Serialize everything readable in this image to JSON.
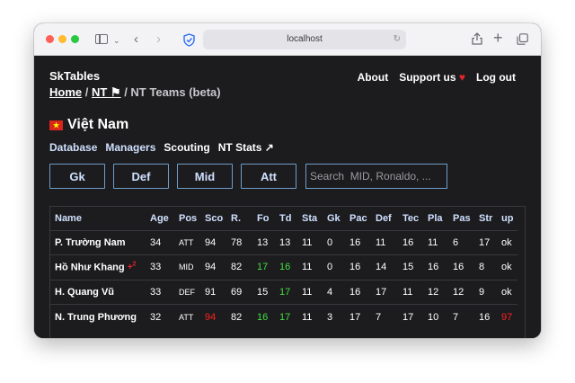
{
  "browser": {
    "url": "localhost"
  },
  "header": {
    "brand": "SkTables",
    "breadcrumb": {
      "home": "Home",
      "nt": "NT ⚑",
      "sep": " / ",
      "current": "NT Teams (beta)"
    },
    "nav": {
      "about": "About",
      "support": "Support us",
      "heart": "♥",
      "logout": "Log out"
    }
  },
  "country": {
    "name": "Việt Nam",
    "flag_star": "★",
    "flag_color": "#da251d"
  },
  "subnav": {
    "database": "Database",
    "managers": "Managers",
    "scouting": "Scouting",
    "ntstats": "NT Stats ↗"
  },
  "filters": {
    "gk": "Gk",
    "def": "Def",
    "mid": "Mid",
    "att": "Att",
    "search_placeholder": "Search  MID, Ronaldo, ..."
  },
  "table": {
    "headers": [
      "Name",
      "Age",
      "Pos",
      "Sco",
      "R.",
      "Fo",
      "Td",
      "Sta",
      "Gk",
      "Pac",
      "Def",
      "Tec",
      "Pla",
      "Pas",
      "Str",
      "up"
    ],
    "rows": [
      {
        "name": "P. Trường Nam",
        "injury": "",
        "age": "34",
        "pos": "ATT",
        "sco": "94",
        "r": "78",
        "fo": "13",
        "td": "13",
        "sta": "11",
        "gk": "0",
        "pac": "16",
        "def": "11",
        "tec": "16",
        "pla": "11",
        "pas": "6",
        "str": "17",
        "up": "ok"
      },
      {
        "name": "Hồ Như Khang",
        "injury": "+",
        "injury_weeks": "2",
        "age": "33",
        "pos": "MID",
        "sco": "94",
        "r": "82",
        "fo": "17",
        "td": "16",
        "sta": "11",
        "gk": "0",
        "pac": "16",
        "def": "14",
        "tec": "15",
        "pla": "16",
        "pas": "16",
        "str": "8",
        "up": "ok"
      },
      {
        "name": "H. Quang Vũ",
        "injury": "",
        "age": "33",
        "pos": "DEF",
        "sco": "91",
        "r": "69",
        "fo": "15",
        "td": "17",
        "sta": "11",
        "gk": "4",
        "pac": "16",
        "def": "17",
        "tec": "11",
        "pla": "12",
        "pas": "12",
        "str": "9",
        "up": "ok"
      },
      {
        "name": "N. Trung Phương",
        "injury": "",
        "age": "32",
        "pos": "ATT",
        "sco": "94",
        "r": "82",
        "fo": "16",
        "td": "17",
        "sta": "11",
        "gk": "3",
        "pac": "17",
        "def": "7",
        "tec": "17",
        "pla": "10",
        "pas": "7",
        "str": "16",
        "up": "97"
      }
    ]
  },
  "colors": {
    "accent": "#cfe0ff",
    "border": "#6f9cc8",
    "good": "#44dd44",
    "bad": "#ff2020",
    "bg": "#1c1c1e"
  }
}
